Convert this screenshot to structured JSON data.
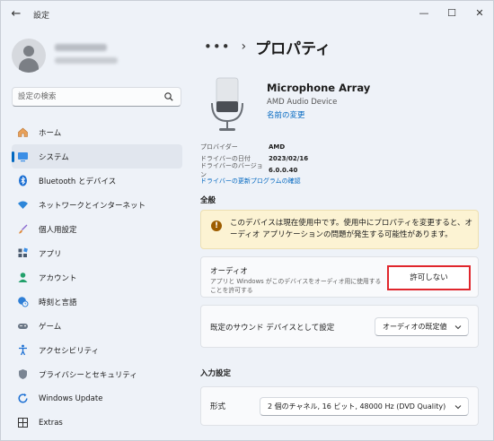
{
  "window": {
    "title": "設定",
    "back_glyph": "←",
    "minimize_glyph": "—",
    "maximize_glyph": "☐",
    "close_glyph": "✕"
  },
  "search": {
    "placeholder": "設定の検索"
  },
  "sidebar": {
    "items": [
      {
        "label": "ホーム",
        "icon": "home-icon"
      },
      {
        "label": "システム",
        "icon": "system-icon",
        "active": true
      },
      {
        "label": "Bluetooth とデバイス",
        "icon": "bluetooth-icon"
      },
      {
        "label": "ネットワークとインターネット",
        "icon": "wifi-icon"
      },
      {
        "label": "個人用設定",
        "icon": "brush-icon"
      },
      {
        "label": "アプリ",
        "icon": "apps-icon"
      },
      {
        "label": "アカウント",
        "icon": "account-icon"
      },
      {
        "label": "時刻と言語",
        "icon": "globe-clock-icon"
      },
      {
        "label": "ゲーム",
        "icon": "gamepad-icon"
      },
      {
        "label": "アクセシビリティ",
        "icon": "accessibility-icon"
      },
      {
        "label": "プライバシーとセキュリティ",
        "icon": "shield-icon"
      },
      {
        "label": "Windows Update",
        "icon": "update-icon"
      },
      {
        "label": "Extras",
        "icon": "extras-icon"
      }
    ]
  },
  "breadcrumb": {
    "dots": "•••",
    "separator": "›",
    "title": "プロパティ"
  },
  "device": {
    "name": "Microphone Array",
    "subtitle": "AMD Audio Device",
    "rename_link": "名前の変更",
    "props": [
      {
        "label": "プロバイダー",
        "value": "AMD"
      },
      {
        "label": "ドライバーの日付",
        "value": "2023/02/16"
      },
      {
        "label": "ドライバーのバージョン",
        "value": "6.0.0.40"
      }
    ],
    "driver_update_link": "ドライバーの更新プログラムの確認"
  },
  "general": {
    "heading": "全般",
    "warning": "このデバイスは現在使用中です。使用中にプロパティを変更すると、オーディオ アプリケーションの問題が発生する可能性があります。",
    "audio": {
      "title": "オーディオ",
      "description": "アプリと Windows がこのデバイスをオーディオ用に使用することを許可する",
      "button": "許可しない"
    },
    "default_device": {
      "title": "既定のサウンド デバイスとして設定",
      "value": "オーディオの既定値"
    }
  },
  "input_settings": {
    "heading": "入力設定",
    "format": {
      "title": "形式",
      "value": "2 個のチャネル, 16 ビット, 48000 Hz (DVD Quality)"
    }
  },
  "colors": {
    "accent": "#0067c0",
    "highlight_border": "#e0262c",
    "warning_bg": "#fcf3d3"
  }
}
